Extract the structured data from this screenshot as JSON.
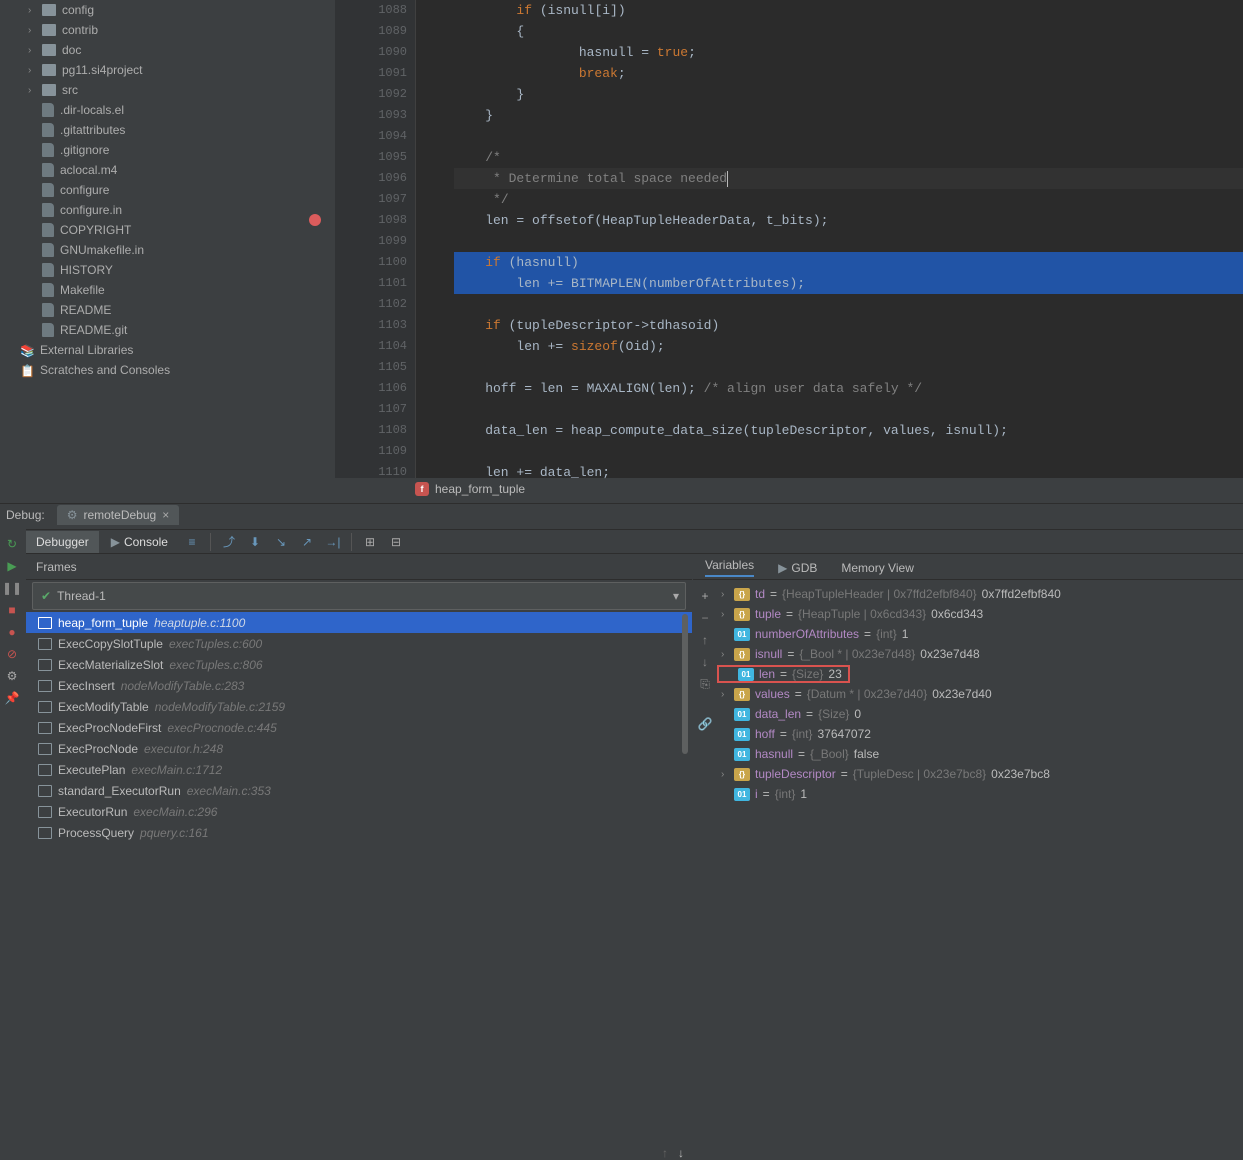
{
  "tree": {
    "folders": [
      "config",
      "contrib",
      "doc",
      "pg11.si4project",
      "src"
    ],
    "files": [
      ".dir-locals.el",
      ".gitattributes",
      ".gitignore",
      "aclocal.m4",
      "configure",
      "configure.in",
      "COPYRIGHT",
      "GNUmakefile.in",
      "HISTORY",
      "Makefile",
      "README",
      "README.git"
    ],
    "external": "External Libraries",
    "scratches": "Scratches and Consoles"
  },
  "code": {
    "startLine": 1088,
    "breakpointLine": 1098,
    "execLine": 1100,
    "breadcrumb": "heap_form_tuple"
  },
  "debug": {
    "label": "Debug:",
    "configName": "remoteDebug",
    "tabs": {
      "debugger": "Debugger",
      "console": "Console"
    },
    "framesTitle": "Frames",
    "thread": "Thread-1",
    "frames": [
      {
        "name": "heap_form_tuple",
        "loc": "heaptuple.c:1100",
        "selected": true
      },
      {
        "name": "ExecCopySlotTuple",
        "loc": "execTuples.c:600"
      },
      {
        "name": "ExecMaterializeSlot",
        "loc": "execTuples.c:806"
      },
      {
        "name": "ExecInsert",
        "loc": "nodeModifyTable.c:283"
      },
      {
        "name": "ExecModifyTable",
        "loc": "nodeModifyTable.c:2159"
      },
      {
        "name": "ExecProcNodeFirst",
        "loc": "execProcnode.c:445"
      },
      {
        "name": "ExecProcNode",
        "loc": "executor.h:248"
      },
      {
        "name": "ExecutePlan",
        "loc": "execMain.c:1712"
      },
      {
        "name": "standard_ExecutorRun",
        "loc": "execMain.c:353"
      },
      {
        "name": "ExecutorRun",
        "loc": "execMain.c:296"
      },
      {
        "name": "ProcessQuery",
        "loc": "pquery.c:161"
      }
    ],
    "varTabs": {
      "variables": "Variables",
      "gdb": "GDB",
      "memory": "Memory View"
    },
    "variables": [
      {
        "name": "td",
        "type": "{HeapTupleHeader | 0x7ffd2efbf840}",
        "val": "0x7ffd2efbf840",
        "badge": "struct",
        "chev": true
      },
      {
        "name": "tuple",
        "type": "{HeapTuple | 0x6cd343}",
        "val": "0x6cd343",
        "badge": "struct",
        "chev": true
      },
      {
        "name": "numberOfAttributes",
        "type": "{int}",
        "val": "1",
        "badge": "prim",
        "chev": false
      },
      {
        "name": "isnull",
        "type": "{_Bool * | 0x23e7d48}",
        "val": "0x23e7d48",
        "badge": "struct",
        "chev": true
      },
      {
        "name": "len",
        "type": "{Size}",
        "val": "23",
        "badge": "prim",
        "chev": false,
        "highlight": true
      },
      {
        "name": "values",
        "type": "{Datum * | 0x23e7d40}",
        "val": "0x23e7d40",
        "badge": "struct",
        "chev": true
      },
      {
        "name": "data_len",
        "type": "{Size}",
        "val": "0",
        "badge": "prim",
        "chev": false
      },
      {
        "name": "hoff",
        "type": "{int}",
        "val": "37647072",
        "badge": "prim",
        "chev": false
      },
      {
        "name": "hasnull",
        "type": "{_Bool}",
        "val": "false",
        "badge": "prim",
        "chev": false
      },
      {
        "name": "tupleDescriptor",
        "type": "{TupleDesc | 0x23e7bc8}",
        "val": "0x23e7bc8",
        "badge": "struct",
        "chev": true
      },
      {
        "name": "i",
        "type": "{int}",
        "val": "1",
        "badge": "prim",
        "chev": false
      }
    ]
  }
}
